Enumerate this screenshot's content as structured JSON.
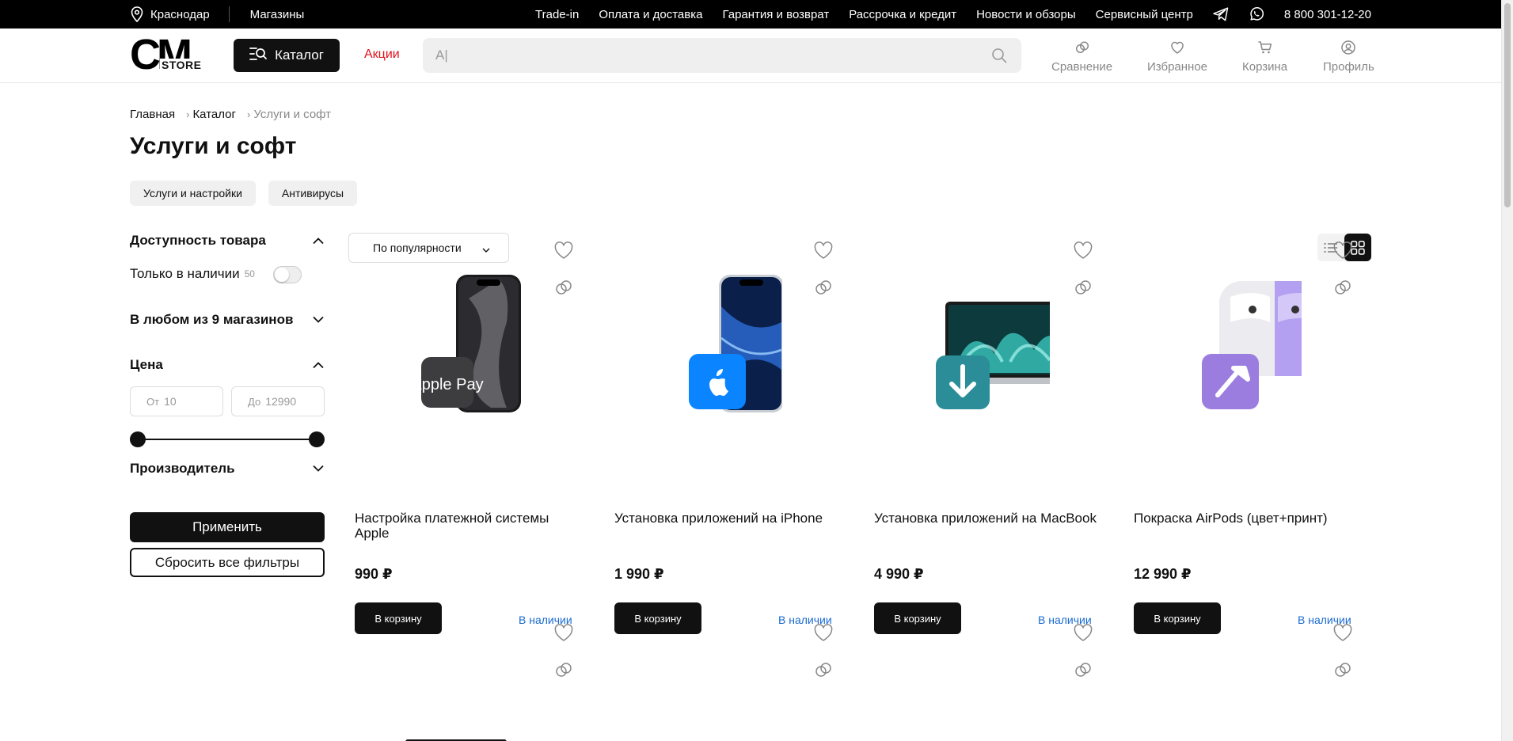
{
  "topbar": {
    "city": "Краснодар",
    "stores": "Магазины",
    "nav": [
      "Trade-in",
      "Оплата и доставка",
      "Гарантия и возврат",
      "Рассрочка и кредит",
      "Новости и обзоры",
      "Сервисный центр"
    ],
    "phone": "8 800 301-12-20"
  },
  "header": {
    "logo_main": "CM",
    "logo_sub": "STORE",
    "catalog_label": "Каталог",
    "promo_label": "Акции",
    "search_value": "А|",
    "compare_label": "Сравнение",
    "favorites_label": "Избранное",
    "cart_label": "Корзина",
    "profile_label": "Профиль"
  },
  "breadcrumb": {
    "home": "Главная",
    "catalog": "Каталог",
    "current": "Услуги и софт"
  },
  "page_title": "Услуги и софт",
  "subcategories": [
    "Услуги и настройки",
    "Антивирусы"
  ],
  "filters": {
    "availability_title": "Доступность товара",
    "in_stock_label": "Только в наличии",
    "in_stock_count": "50",
    "stores_title": "В любом из 9 магазинов",
    "price_title": "Цена",
    "price_from_prefix": "От",
    "price_from": "10",
    "price_to_prefix": "До",
    "price_to": "12990",
    "manufacturer_title": "Производитель",
    "apply_label": "Применить",
    "reset_label": "Сбросить все фильтры"
  },
  "sort": {
    "selected": "По популярности"
  },
  "products": [
    {
      "name": "Настройка платежной системы Apple",
      "price": "990 ₽",
      "cart": "В корзину",
      "availability": "В наличии",
      "badge": "Apple Pay"
    },
    {
      "name": "Установка приложений на iPhone",
      "price": "1 990 ₽",
      "cart": "В корзину",
      "availability": "В наличии",
      "badge": ""
    },
    {
      "name": "Установка приложений на MacBook",
      "price": "4 990 ₽",
      "cart": "В корзину",
      "availability": "В наличии",
      "badge": ""
    },
    {
      "name": "Покраска AirPods (цвет+принт)",
      "price": "12 990 ₽",
      "cart": "В корзину",
      "availability": "В наличии",
      "badge": ""
    }
  ],
  "colors": {
    "accent_dark": "#111111",
    "promo_red": "#e0121c",
    "availability_blue": "#1a6bd1"
  },
  "icons": {
    "location": "location-pin-icon",
    "telegram": "telegram-icon",
    "whatsapp": "whatsapp-icon",
    "search": "search-icon",
    "compare": "compare-icon",
    "favorite": "heart-icon",
    "cart": "cart-icon",
    "profile": "profile-icon",
    "list_view": "list-view-icon",
    "grid_view": "grid-view-icon"
  }
}
